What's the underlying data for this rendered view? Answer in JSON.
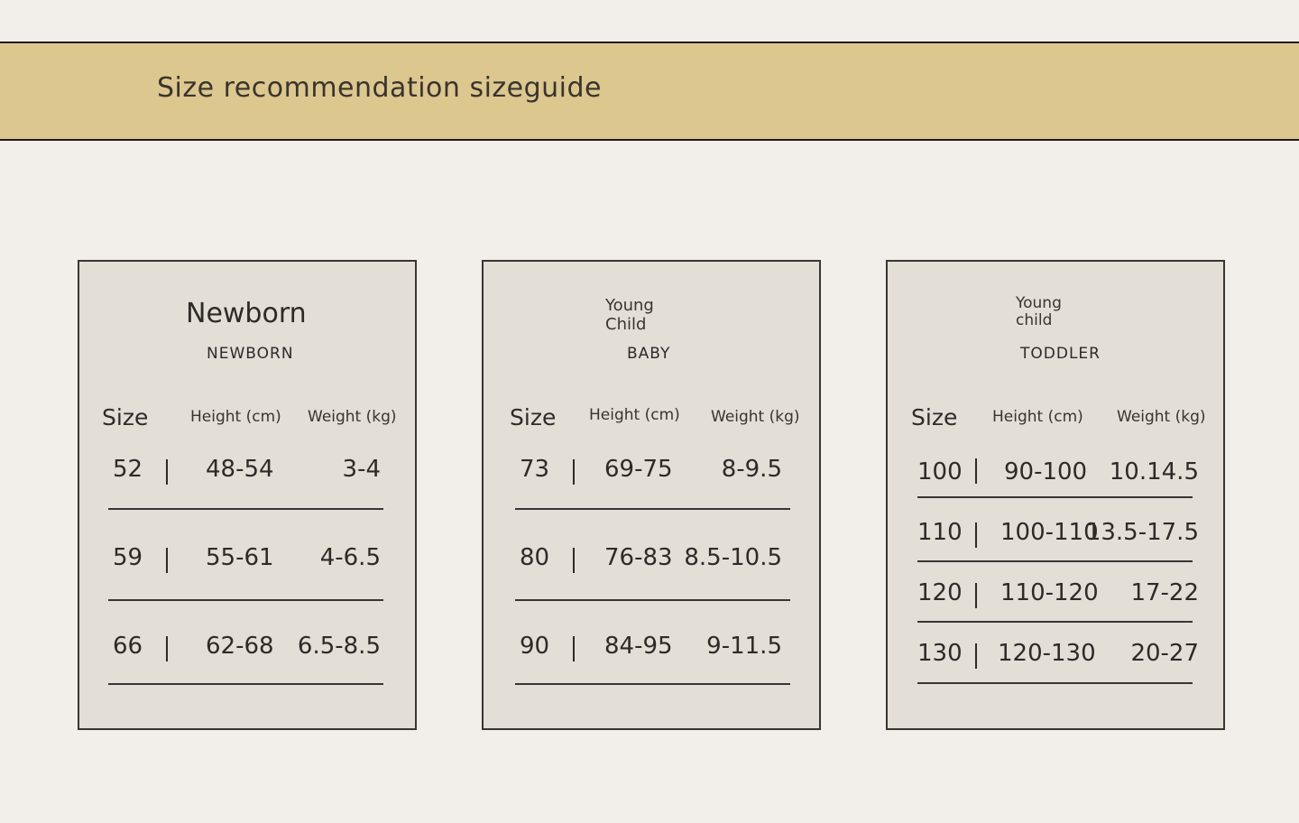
{
  "banner": {
    "title": "Size recommendation sizeguide"
  },
  "cards": [
    {
      "title": "Newborn",
      "subtitle": "NEWBORN",
      "headers": {
        "size": "Size",
        "height": "Height (cm)",
        "weight": "Weight (kg)"
      },
      "rows": [
        {
          "size": "52",
          "height": "48-54",
          "weight": "3-4"
        },
        {
          "size": "59",
          "height": "55-61",
          "weight": "4-6.5"
        },
        {
          "size": "66",
          "height": "62-68",
          "weight": "6.5-8.5"
        }
      ]
    },
    {
      "title": "Young\nChild",
      "subtitle": "BABY",
      "headers": {
        "size": "Size",
        "height": "Height (cm)",
        "weight": "Weight (kg)"
      },
      "rows": [
        {
          "size": "73",
          "height": "69-75",
          "weight": "8-9.5"
        },
        {
          "size": "80",
          "height": "76-83",
          "weight": "8.5-10.5"
        },
        {
          "size": "90",
          "height": "84-95",
          "weight": "9-11.5"
        }
      ]
    },
    {
      "title": "Young\nchild",
      "subtitle": "TODDLER",
      "headers": {
        "size": "Size",
        "height": "Height (cm)",
        "weight": "Weight (kg)"
      },
      "rows": [
        {
          "size": "100",
          "height": "90-100",
          "weight": "10.14.5"
        },
        {
          "size": "110",
          "height": "100-110",
          "weight": "13.5-17.5"
        },
        {
          "size": "120",
          "height": "110-120",
          "weight": "17-22"
        },
        {
          "size": "130",
          "height": "120-130",
          "weight": "20-27"
        }
      ]
    }
  ]
}
